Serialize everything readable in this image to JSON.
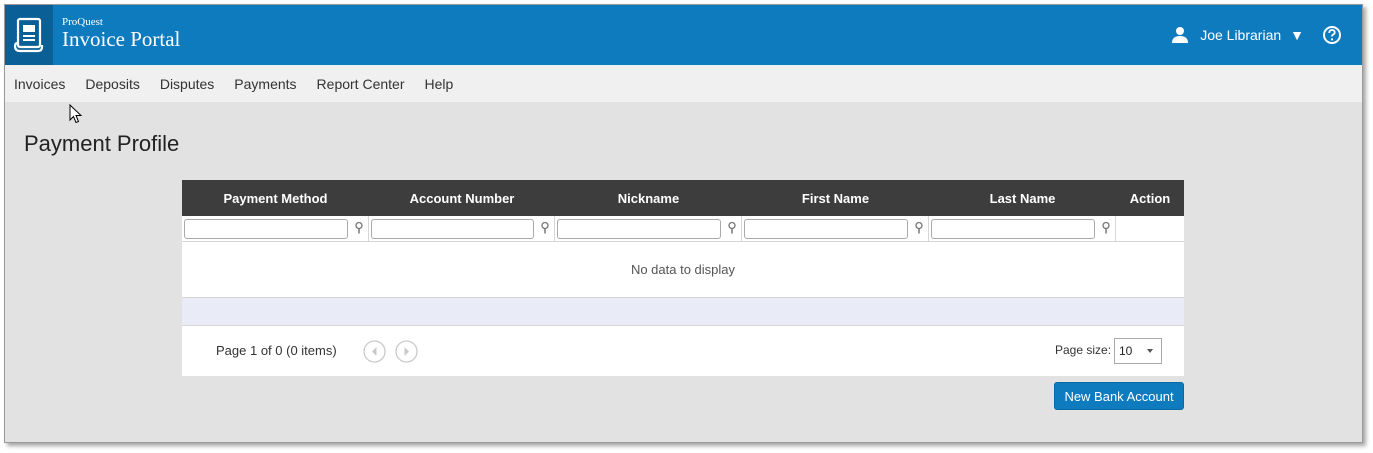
{
  "header": {
    "brand_small": "ProQuest",
    "brand_title": "Invoice Portal",
    "user_name": "Joe Librarian",
    "logo_icon": "invoice-scroll-icon",
    "user_icon": "person-icon",
    "help_icon": "help-circle-icon"
  },
  "menu": {
    "items": [
      {
        "label": "Invoices"
      },
      {
        "label": "Deposits"
      },
      {
        "label": "Disputes"
      },
      {
        "label": "Payments"
      },
      {
        "label": "Report Center"
      },
      {
        "label": "Help"
      }
    ]
  },
  "page": {
    "title": "Payment Profile"
  },
  "grid": {
    "columns": [
      {
        "label": "Payment Method"
      },
      {
        "label": "Account Number"
      },
      {
        "label": "Nickname"
      },
      {
        "label": "First Name"
      },
      {
        "label": "Last Name"
      },
      {
        "label": "Action"
      }
    ],
    "filters": [
      {
        "value": ""
      },
      {
        "value": ""
      },
      {
        "value": ""
      },
      {
        "value": ""
      },
      {
        "value": ""
      }
    ],
    "empty_message": "No data to display",
    "pager": {
      "info": "Page 1 of 0 (0 items)",
      "page_size_label": "Page size:",
      "page_size_value": "10"
    }
  },
  "actions": {
    "new_bank_account_label": "New Bank Account"
  },
  "colors": {
    "brand_blue": "#0f7bbf",
    "brand_dark_blue": "#0a5f97",
    "grid_header": "#3d3d3d"
  }
}
